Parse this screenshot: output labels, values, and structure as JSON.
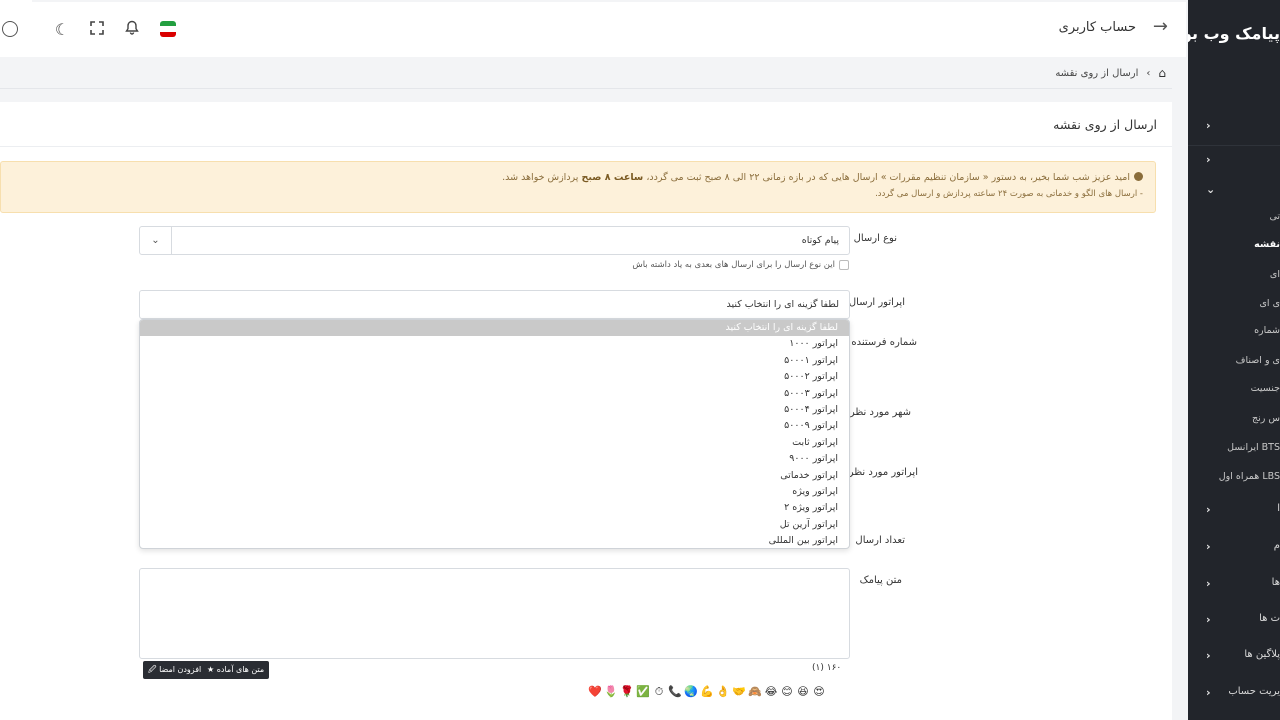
{
  "app": {
    "brand": "پیامک وب بو"
  },
  "header": {
    "title": "حساب کاربری",
    "icons": [
      "back-arrow-icon",
      "user-icon",
      "moon-icon",
      "fullscreen-icon",
      "bell-icon",
      "iran-flag-icon"
    ]
  },
  "breadcrumb": {
    "home": "⌂",
    "current": "ارسال از روی نقشه"
  },
  "card": {
    "title": "ارسال از روی نقشه"
  },
  "alert": {
    "line1_pre": "امید عزیز شب شما بخیر، به دستور « سازمان تنظیم مقررات » ارسال هایی که در بازه زمانی ۲۲ الی ۸ صبح ثبت می گردد،",
    "line1_bold": "ساعت ۸ صبح",
    "line1_post": "پردازش خواهد شد.",
    "line2": "- ارسال های الگو و خدماتی به صورت ۲۴ ساعته پردازش و ارسال می گردد."
  },
  "form": {
    "send_type_label": "نوع ارسال",
    "send_type_value": "پیام کوتاه",
    "remember_label": "این نوع ارسال را برای ارسال های بعدی به یاد داشته باش",
    "operator_label": "اپراتور ارسال",
    "operator_placeholder": "لطفا گزینه ای را انتخاب کنید",
    "sender_number_label": "شماره فرستنده",
    "city_label": "شهر مورد نظر",
    "target_operator_label": "اپراتور مورد نظر",
    "count_label": "تعداد ارسال",
    "message_label": "متن پیامک",
    "counter": "۱۶۰ (۱)",
    "ready_texts_button": "متن های آماده ★",
    "add_signature_button": "افزودن امضا 🖉"
  },
  "operator_options": [
    "لطفا گزینه ای را انتخاب کنید",
    "اپراتور ۱۰۰۰",
    "اپراتور ۵۰۰۰۱",
    "اپراتور ۵۰۰۰۲",
    "اپراتور ۵۰۰۰۳",
    "اپراتور ۵۰۰۰۴",
    "اپراتور ۵۰۰۰۹",
    "اپراتور ثابت",
    "اپراتور ۹۰۰۰",
    "اپراتور خدماتی",
    "اپراتور ویژه",
    "اپراتور ویژه ۲",
    "اپراتور آرین تل",
    "اپراتور بین المللی"
  ],
  "emojis": [
    "😍",
    "😆",
    "😊",
    "😂",
    "🙈",
    "🤝",
    "👌",
    "💪",
    "🌏",
    "📞",
    "⏱",
    "✅",
    "🌹",
    "🌷",
    "❤️"
  ],
  "sidebar": {
    "items": [
      {
        "label": "",
        "chev": "›"
      },
      {
        "label": "",
        "chev": "›"
      },
      {
        "label": "",
        "chev": "⌄"
      },
      {
        "label": "تی",
        "sub": true
      },
      {
        "label": "نقشه",
        "sub": true,
        "active": true
      },
      {
        "label": "ای",
        "sub": true
      },
      {
        "label": "ی ای",
        "sub": true
      },
      {
        "label": "شماره",
        "sub": true
      },
      {
        "label": "ی و اصناف",
        "sub": true
      },
      {
        "label": "جنسیت",
        "sub": true
      },
      {
        "label": "س رنج",
        "sub": true
      },
      {
        "label": "BTS ایرانسل",
        "sub": true
      },
      {
        "label": "LBS همراه اول",
        "sub": true
      },
      {
        "label": "ا",
        "chev": "›"
      },
      {
        "label": "م",
        "chev": "›"
      },
      {
        "label": "ها",
        "chev": "›"
      },
      {
        "label": "ت ها",
        "chev": "›"
      },
      {
        "label": "پلاگین ها",
        "chev": "›"
      },
      {
        "label": "یریت حساب",
        "chev": "›"
      }
    ]
  }
}
